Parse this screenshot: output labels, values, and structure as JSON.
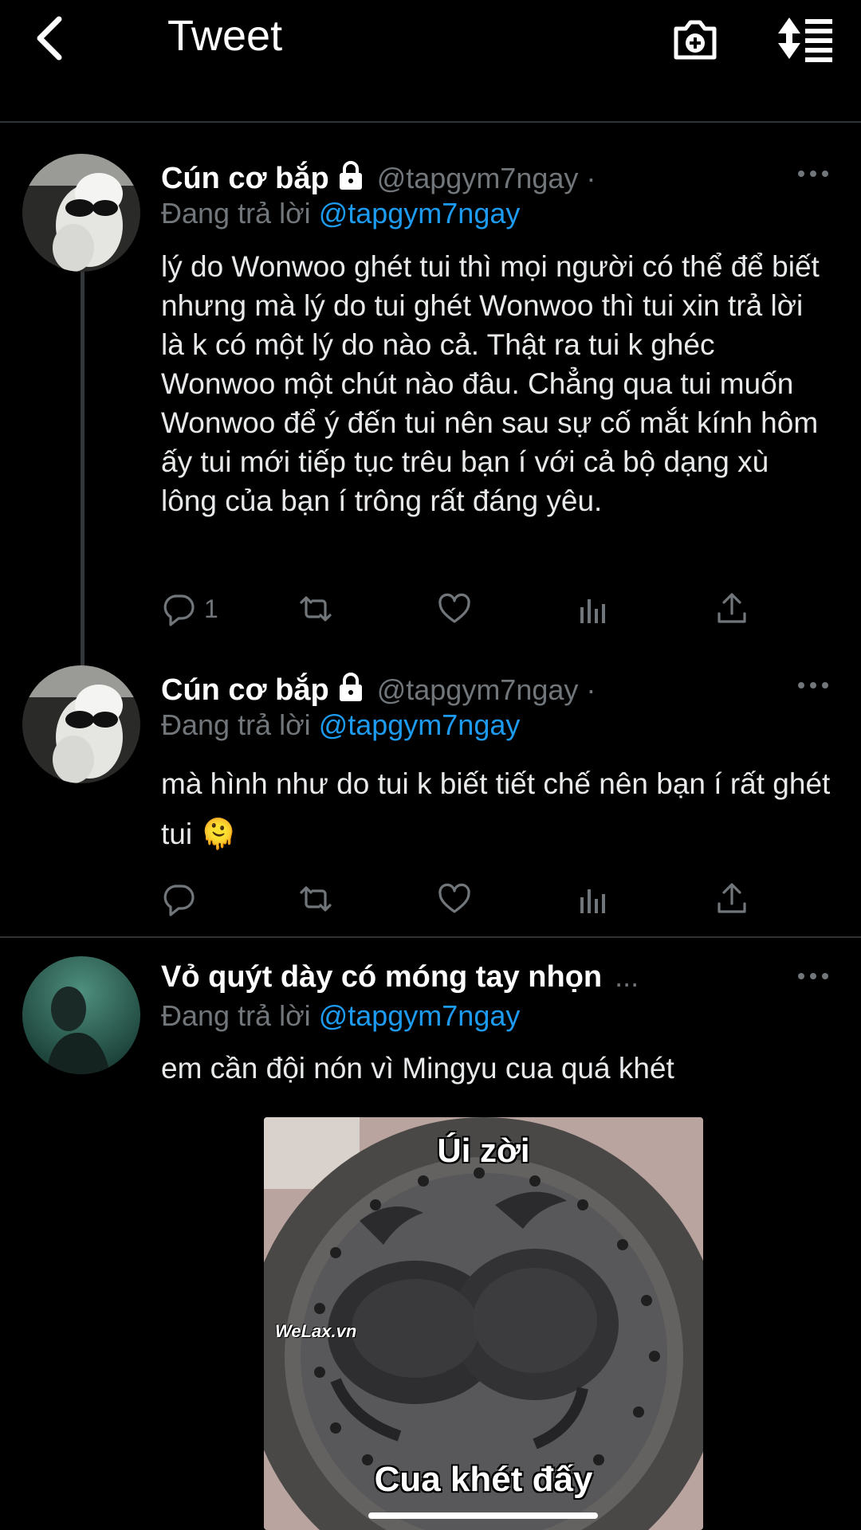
{
  "header": {
    "title": "Tweet"
  },
  "tweets": [
    {
      "name": "Cún cơ bắp",
      "handle": "@tapgym7ngay ·",
      "replying_label": "Đang trả lời",
      "replying_to": "@tapgym7ngay",
      "text": "lý do Wonwoo ghét tui thì mọi người có thể để biết nhưng mà lý do tui ghét Wonwoo thì tui xin trả lời là k có một lý do nào cả. Thật ra tui k ghéc Wonwoo một chút nào đâu. Chẳng qua tui muốn Wonwoo để ý đến tui nên sau sự cố mắt kính hôm ấy tui mới tiếp tục trêu bạn í với cả bộ dạng xù lông của bạn í trông rất đáng yêu.",
      "reply_count": "1"
    },
    {
      "name": "Cún cơ bắp",
      "handle": "@tapgym7ngay ·",
      "replying_label": "Đang trả lời",
      "replying_to": "@tapgym7ngay",
      "text": "mà hình như do tui k biết tiết chế nên bạn í rất ghét tui",
      "emoji": "🫠",
      "reply_count": ""
    },
    {
      "name": "Vỏ quýt dày có móng tay nhọn",
      "handle": "...",
      "replying_label": "Đang trả lời",
      "replying_to": "@tapgym7ngay",
      "text": "em cần đội nón vì Mingyu cua quá khét",
      "image": {
        "top_caption": "Úi zời",
        "bottom_caption": "Cua khét đấy",
        "watermark": "WeLax.vn"
      }
    }
  ],
  "colors": {
    "background": "#000000",
    "link": "#1d9bf0",
    "muted": "#71767b",
    "divider": "#2f3336"
  }
}
